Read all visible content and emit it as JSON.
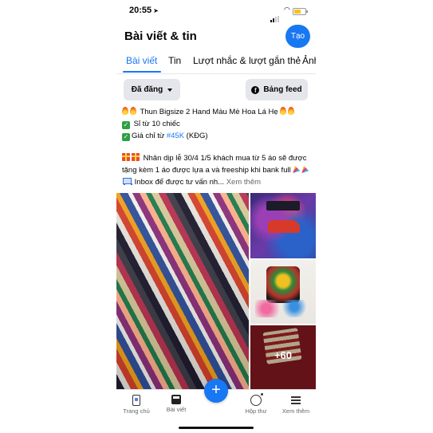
{
  "status_bar": {
    "time": "20:55"
  },
  "header": {
    "title": "Bài viết & tin",
    "create_label": "Tạo"
  },
  "tabs": [
    {
      "label": "Bài viết",
      "active": true
    },
    {
      "label": "Tin",
      "active": false
    },
    {
      "label": "Lượt nhắc & lượt gắn thẻ",
      "active": false
    },
    {
      "label": "Ảnh",
      "active": false
    }
  ],
  "filters": {
    "published_label": "Đã đăng",
    "feed_label": "Bảng feed"
  },
  "post": {
    "line1": "Thun Bigsize 2 Hand Màu Mè Hoa Lá Hẹ",
    "line2": "Sỉ từ 10 chiếc",
    "line3_prefix": "Giá chỉ từ ",
    "line3_hashtag": "#45K",
    "line3_suffix": " (KĐG)",
    "line4": "Nhân dịp lễ 30/4 1/5 khách mua từ 5 áo sẽ được",
    "line5": "tặng kèm 1 áo được lựa a và freeship khi bank full",
    "line6": "Inbox để được tư vấn nh...",
    "see_more": "Xem thêm"
  },
  "photos": {
    "more_count": "+60"
  },
  "bottom_nav": {
    "home": "Trang chủ",
    "posts": "Bài viết",
    "inbox": "Hộp thư",
    "more": "Xem thêm"
  },
  "colors": {
    "accent": "#1877f2",
    "pill_bg": "#e4e6eb",
    "muted": "#65676b"
  },
  "icons": [
    "navigation-arrow-icon",
    "signal-icon",
    "wifi-icon",
    "battery-icon",
    "caret-down-icon",
    "facebook-icon",
    "fire-icon",
    "check-icon",
    "gift-icon",
    "party-icon",
    "cart-icon",
    "plus-icon",
    "home-icon",
    "posts-icon",
    "inbox-icon",
    "menu-icon"
  ]
}
